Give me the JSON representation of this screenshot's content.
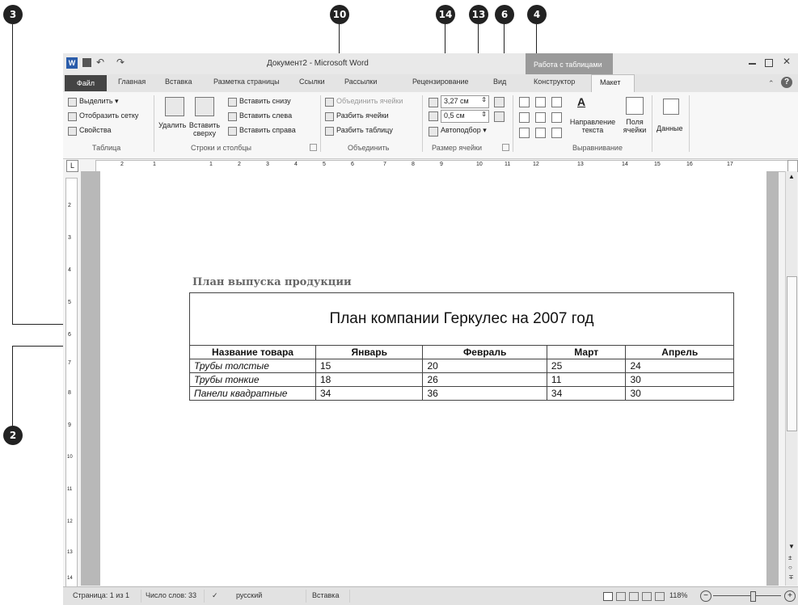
{
  "callouts": [
    "3",
    "10",
    "14",
    "13",
    "6",
    "4",
    "2"
  ],
  "app": {
    "title": "Документ2 - Microsoft Word",
    "context_tab_group": "Работа с таблицами",
    "qat": {
      "undo": "↶",
      "redo": "↷"
    }
  },
  "menu": {
    "file": "Файл",
    "tabs": [
      "Главная",
      "Вставка",
      "Разметка страницы",
      "Ссылки",
      "Рассылки",
      "Рецензирование",
      "Вид",
      "Конструктор",
      "Макет"
    ]
  },
  "ribbon": {
    "table": {
      "select": "Выделить ▾",
      "gridlines": "Отобразить сетку",
      "properties": "Свойства",
      "label": "Таблица"
    },
    "rows_cols": {
      "delete": "Удалить",
      "insert_above": "Вставить сверху",
      "insert_below": "Вставить снизу",
      "insert_left": "Вставить слева",
      "insert_right": "Вставить справа",
      "label": "Строки и столбцы"
    },
    "merge": {
      "merge_cells": "Объединить ячейки",
      "split_cells": "Разбить ячейки",
      "split_table": "Разбить таблицу",
      "label": "Объединить"
    },
    "cell_size": {
      "height": "3,27 см",
      "width": "0,5 см",
      "autofit": "Автоподбор ▾",
      "label": "Размер ячейки"
    },
    "alignment": {
      "text_direction": "Направление текста",
      "cell_margins": "Поля ячейки",
      "label": "Выравнивание"
    },
    "data": {
      "label": "Данные"
    }
  },
  "ruler_numbers": [
    "2",
    "1",
    "1",
    "2",
    "3",
    "4",
    "5",
    "6",
    "7",
    "8",
    "9",
    "10",
    "11",
    "12",
    "13",
    "14",
    "15",
    "16",
    "17"
  ],
  "vruler_numbers": [
    "2",
    "3",
    "4",
    "5",
    "6",
    "7",
    "8",
    "9",
    "10",
    "11",
    "12",
    "13",
    "14"
  ],
  "document": {
    "heading": "План выпуска продукции",
    "table_title": "План компании Геркулес на 2007 год",
    "columns": [
      "Название товара",
      "Январь",
      "Февраль",
      "Март",
      "Апрель"
    ],
    "rows": [
      [
        "Трубы толстые",
        "15",
        "20",
        "25",
        "24"
      ],
      [
        "Трубы тонкие",
        "18",
        "26",
        "11",
        "30"
      ],
      [
        "Панели квадратные",
        "34",
        "36",
        "34",
        "30"
      ]
    ]
  },
  "status": {
    "page": "Страница: 1 из 1",
    "words": "Число слов: 33",
    "language": "русский",
    "mode": "Вставка",
    "zoom": "118%"
  }
}
